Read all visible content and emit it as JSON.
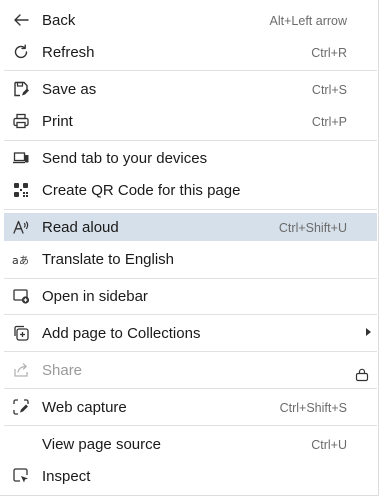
{
  "menu": {
    "items": [
      {
        "label": "Back",
        "shortcut": "Alt+Left arrow",
        "icon": "back-arrow-icon"
      },
      {
        "label": "Refresh",
        "shortcut": "Ctrl+R",
        "icon": "refresh-icon"
      },
      {
        "label": "Save as",
        "shortcut": "Ctrl+S",
        "icon": "save-as-icon"
      },
      {
        "label": "Print",
        "shortcut": "Ctrl+P",
        "icon": "printer-icon"
      },
      {
        "label": "Send tab to your devices",
        "shortcut": "",
        "icon": "send-to-devices-icon"
      },
      {
        "label": "Create QR Code for this page",
        "shortcut": "",
        "icon": "qr-code-icon"
      },
      {
        "label": "Read aloud",
        "shortcut": "Ctrl+Shift+U",
        "icon": "read-aloud-icon",
        "highlighted": true
      },
      {
        "label": "Translate to English",
        "shortcut": "",
        "icon": "translate-icon"
      },
      {
        "label": "Open in sidebar",
        "shortcut": "",
        "icon": "open-in-sidebar-icon"
      },
      {
        "label": "Add page to Collections",
        "shortcut": "",
        "icon": "collections-add-icon",
        "submenu": true
      },
      {
        "label": "Share",
        "shortcut": "",
        "icon": "share-icon",
        "disabled": true
      },
      {
        "label": "Web capture",
        "shortcut": "Ctrl+Shift+S",
        "icon": "web-capture-icon"
      },
      {
        "label": "View page source",
        "shortcut": "Ctrl+U",
        "icon": ""
      },
      {
        "label": "Inspect",
        "shortcut": "",
        "icon": "inspect-icon"
      }
    ]
  },
  "colors": {
    "highlight": "#d6e0ea",
    "text": "#1a1a1a",
    "shortcut": "#6b6b6b",
    "disabled": "#9a9a9a",
    "separator": "#e1e1e1"
  }
}
